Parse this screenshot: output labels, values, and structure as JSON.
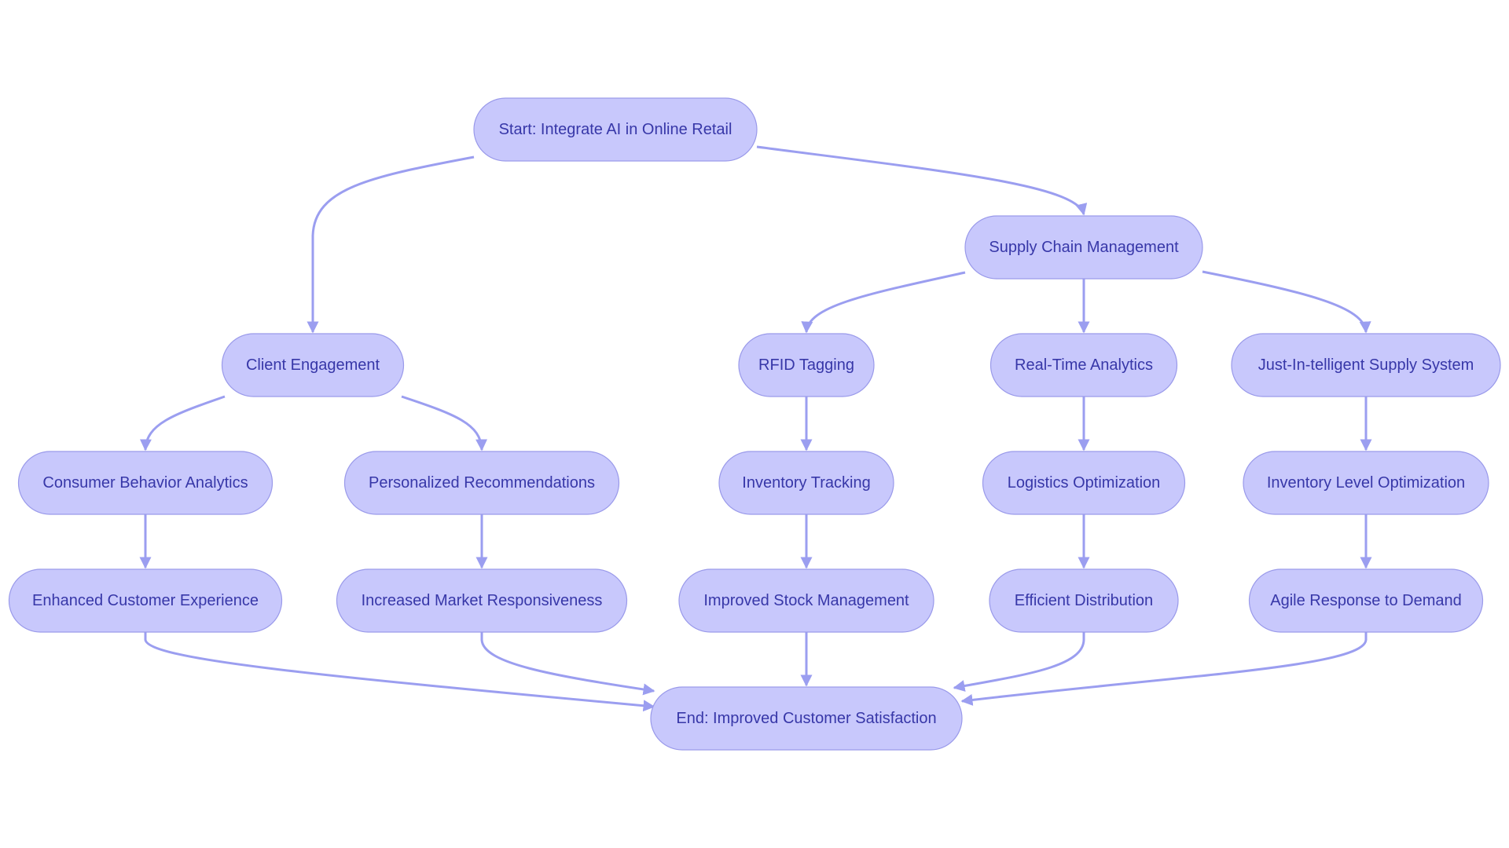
{
  "diagram": {
    "type": "flowchart",
    "colors": {
      "node_fill": "#c8c8fc",
      "node_stroke": "#9a9aea",
      "text": "#3737a8",
      "edge": "#9b9ef0"
    },
    "nodes": [
      {
        "id": "start",
        "label": "Start: Integrate AI in Online Retail"
      },
      {
        "id": "client",
        "label": "Client Engagement"
      },
      {
        "id": "supply",
        "label": "Supply Chain Management"
      },
      {
        "id": "consumer",
        "label": "Consumer Behavior Analytics"
      },
      {
        "id": "personal",
        "label": "Personalized Recommendations"
      },
      {
        "id": "rfid",
        "label": "RFID Tagging"
      },
      {
        "id": "realtime",
        "label": "Real-Time Analytics"
      },
      {
        "id": "justin",
        "label": "Just-In-telligent Supply System"
      },
      {
        "id": "enhanced",
        "label": "Enhanced Customer Experience"
      },
      {
        "id": "increased",
        "label": "Increased Market Responsiveness"
      },
      {
        "id": "invtrack",
        "label": "Inventory Tracking"
      },
      {
        "id": "logistics",
        "label": "Logistics Optimization"
      },
      {
        "id": "invlevel",
        "label": "Inventory Level Optimization"
      },
      {
        "id": "stock",
        "label": "Improved Stock Management"
      },
      {
        "id": "efficient",
        "label": "Efficient Distribution"
      },
      {
        "id": "agile",
        "label": "Agile Response to Demand"
      },
      {
        "id": "end",
        "label": "End: Improved Customer Satisfaction"
      }
    ],
    "edges": [
      {
        "from": "start",
        "to": "client"
      },
      {
        "from": "start",
        "to": "supply"
      },
      {
        "from": "client",
        "to": "consumer"
      },
      {
        "from": "client",
        "to": "personal"
      },
      {
        "from": "supply",
        "to": "rfid"
      },
      {
        "from": "supply",
        "to": "realtime"
      },
      {
        "from": "supply",
        "to": "justin"
      },
      {
        "from": "consumer",
        "to": "enhanced"
      },
      {
        "from": "personal",
        "to": "increased"
      },
      {
        "from": "rfid",
        "to": "invtrack"
      },
      {
        "from": "invtrack",
        "to": "stock"
      },
      {
        "from": "realtime",
        "to": "logistics"
      },
      {
        "from": "logistics",
        "to": "efficient"
      },
      {
        "from": "justin",
        "to": "invlevel"
      },
      {
        "from": "invlevel",
        "to": "agile"
      },
      {
        "from": "enhanced",
        "to": "end"
      },
      {
        "from": "increased",
        "to": "end"
      },
      {
        "from": "stock",
        "to": "end"
      },
      {
        "from": "efficient",
        "to": "end"
      },
      {
        "from": "agile",
        "to": "end"
      }
    ]
  }
}
